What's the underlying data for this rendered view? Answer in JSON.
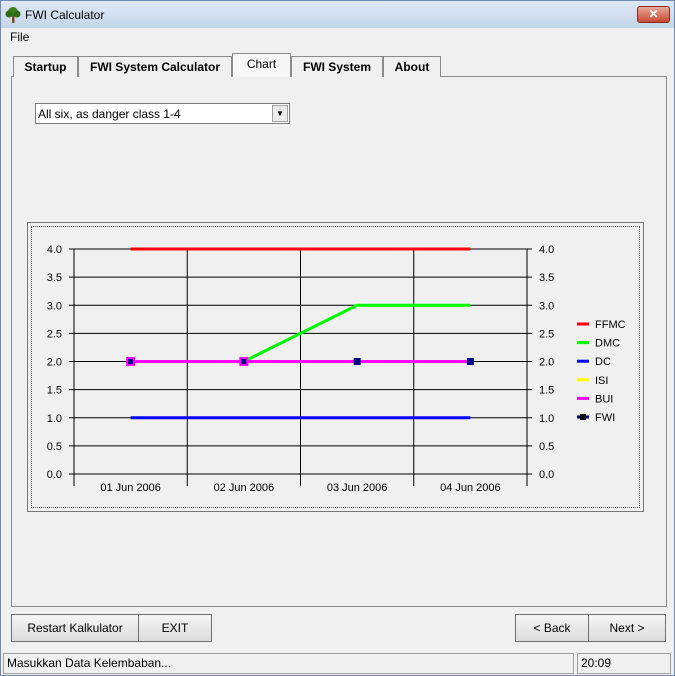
{
  "window": {
    "title": "FWI Calculator",
    "close_label": "✕"
  },
  "menu": {
    "file": "File"
  },
  "tabs": [
    {
      "label": "Startup"
    },
    {
      "label": "FWI System Calculator"
    },
    {
      "label": "Chart"
    },
    {
      "label": "FWI System"
    },
    {
      "label": "About"
    }
  ],
  "combo": {
    "value": "All six, as danger class 1-4"
  },
  "chart_data": {
    "type": "line",
    "categories": [
      "01 Jun 2006",
      "02 Jun 2006",
      "03 Jun 2006",
      "04 Jun 2006"
    ],
    "x": [
      1,
      2,
      3,
      4
    ],
    "xlim": [
      0.5,
      4.5
    ],
    "ylim": [
      0,
      4
    ],
    "yticks": [
      0.0,
      0.5,
      1.0,
      1.5,
      2.0,
      2.5,
      3.0,
      3.5,
      4.0
    ],
    "ytick_labels": [
      "0.0",
      "0.5",
      "1.0",
      "1.5",
      "2.0",
      "2.5",
      "3.0",
      "3.5",
      "4.0"
    ],
    "grid": true,
    "legend_position": "right",
    "series": [
      {
        "name": "FFMC",
        "color": "#ff0000",
        "values": [
          4,
          4,
          4,
          4
        ]
      },
      {
        "name": "DMC",
        "color": "#00ff00",
        "values": [
          2,
          2,
          3,
          3
        ]
      },
      {
        "name": "DC",
        "color": "#0000ff",
        "values": [
          1,
          1,
          1,
          1
        ]
      },
      {
        "name": "ISI",
        "color": "#ffff00",
        "values": [
          2,
          2,
          2,
          2
        ]
      },
      {
        "name": "BUI",
        "color": "#ff00ff",
        "values": [
          2,
          2,
          2,
          2
        ]
      },
      {
        "name": "FWI",
        "color": "#000080",
        "marker": "square",
        "values": [
          2,
          2,
          2,
          2
        ]
      }
    ]
  },
  "buttons": {
    "restart": "Restart Kalkulator",
    "exit": "EXIT",
    "back": "< Back",
    "next": "Next >"
  },
  "status": {
    "message": "Masukkan Data Kelembaban...",
    "time": "20:09"
  }
}
